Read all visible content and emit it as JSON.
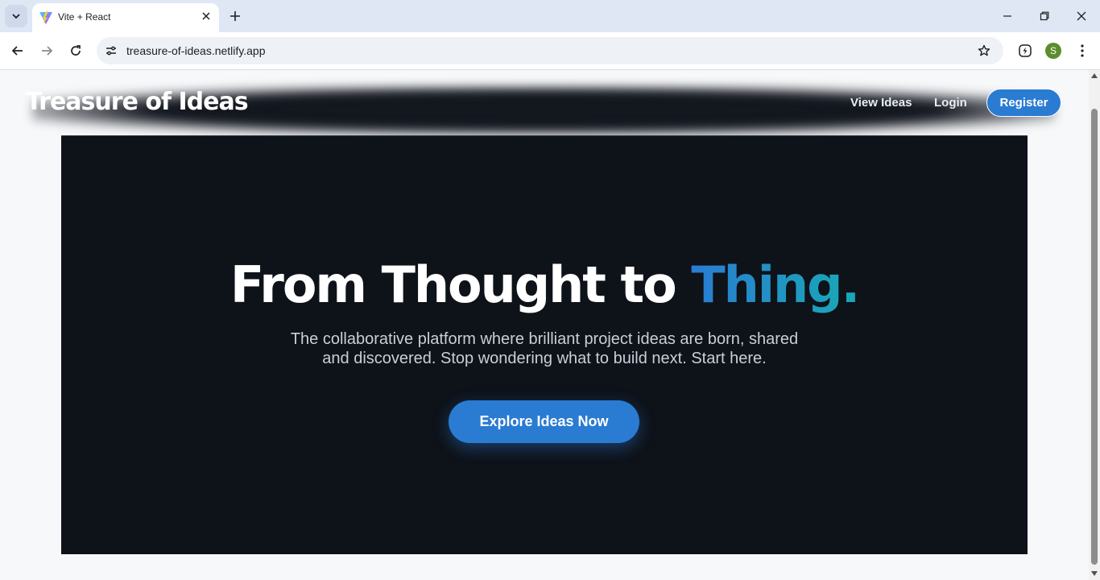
{
  "browser": {
    "tab_title": "Vite + React",
    "url": "treasure-of-ideas.netlify.app",
    "profile_initial": "S"
  },
  "site": {
    "brand": "Treasure of Ideas",
    "nav": {
      "view_ideas": "View Ideas",
      "login": "Login",
      "register": "Register"
    }
  },
  "hero": {
    "headline_main": "From Thought to ",
    "headline_accent": "Thing",
    "headline_dot": ".",
    "subtitle_line1": "The collaborative platform where brilliant project ideas are born, shared",
    "subtitle_line2": "and discovered. Stop wondering what to build next. Start here.",
    "cta": "Explore Ideas Now"
  },
  "colors": {
    "accent": "#2a7bd2",
    "accent_teal": "#1aa5b8",
    "hero_bg": "#0e1219",
    "page_bg": "#f7f8fa"
  },
  "icons": {
    "tab_search": "chevron-down-icon",
    "favicon": "vite-logo-icon",
    "tab_close": "close-icon",
    "new_tab": "plus-icon",
    "back": "arrow-left-icon",
    "forward": "arrow-right-icon",
    "reload": "reload-icon",
    "site_info": "tune-icon",
    "bookmark": "star-icon",
    "extension": "extension-icon",
    "menu": "more-vert-icon"
  }
}
